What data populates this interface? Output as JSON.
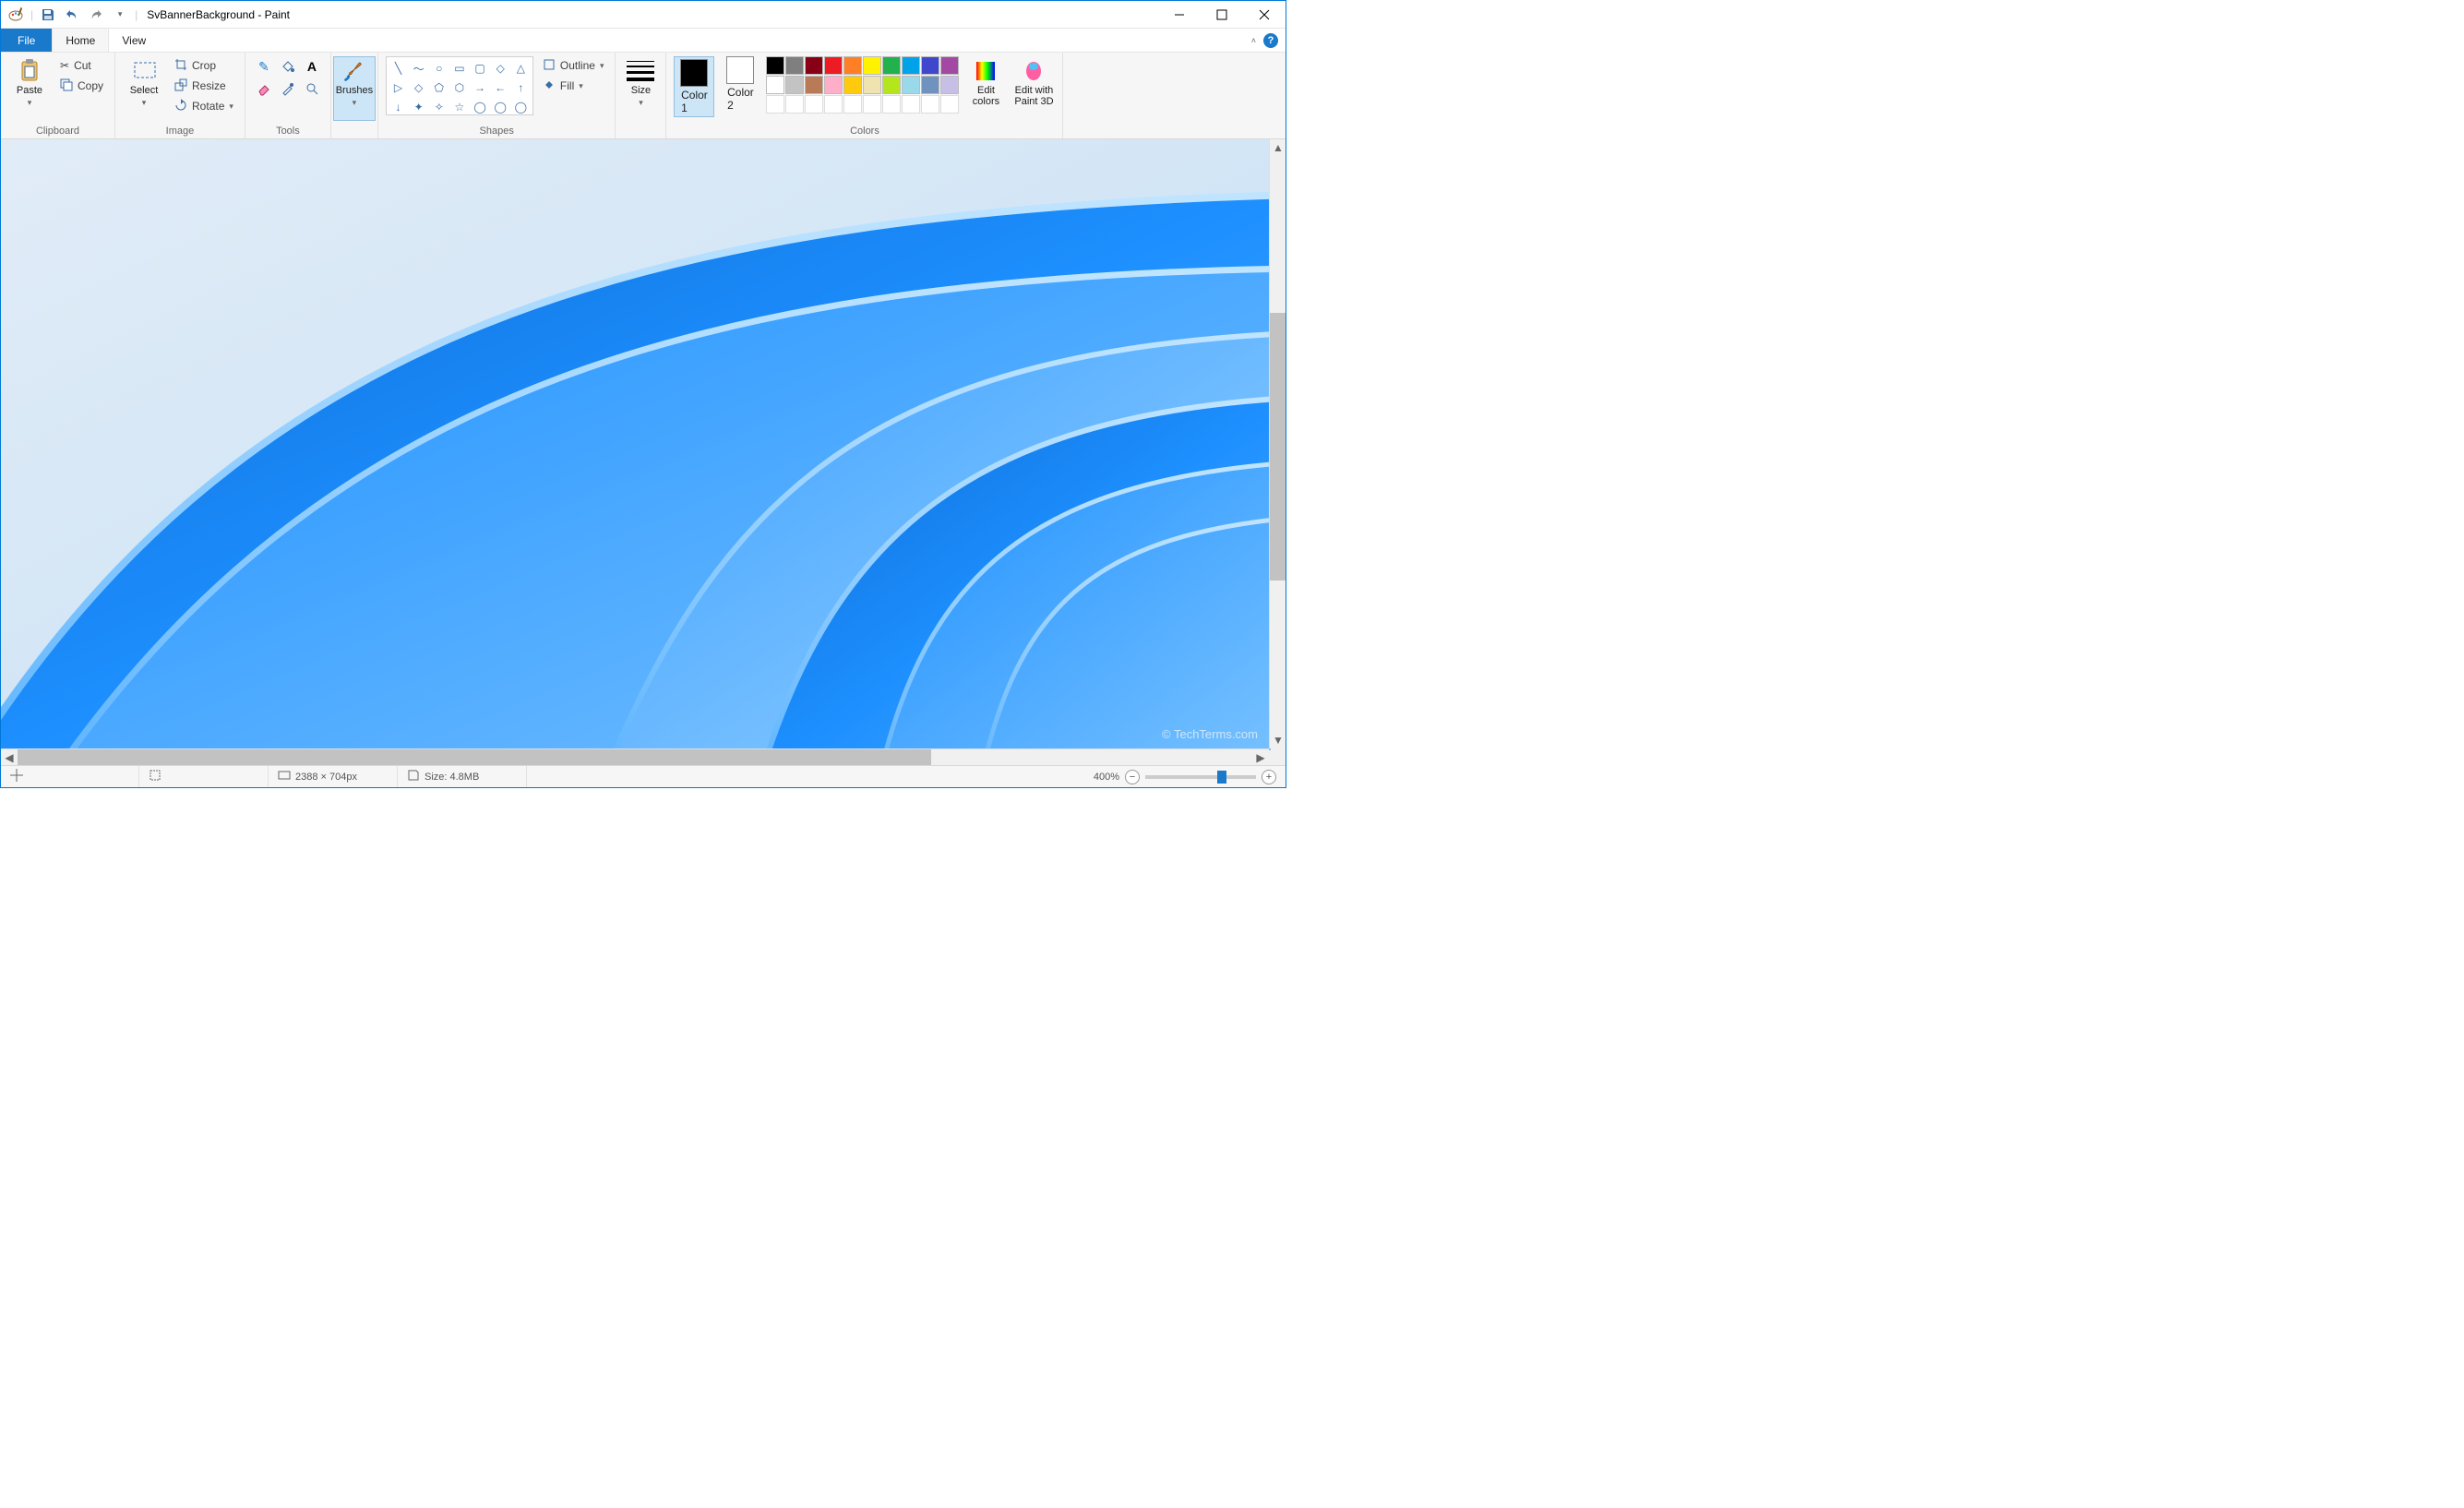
{
  "title": "SvBannerBackground - Paint",
  "qat": {
    "save": "save-icon",
    "undo": "undo-icon",
    "redo": "redo-icon"
  },
  "tabs": {
    "file": "File",
    "home": "Home",
    "view": "View"
  },
  "ribbon": {
    "clipboard": {
      "label": "Clipboard",
      "paste": "Paste",
      "cut": "Cut",
      "copy": "Copy"
    },
    "image": {
      "label": "Image",
      "select": "Select",
      "crop": "Crop",
      "resize": "Resize",
      "rotate": "Rotate"
    },
    "tools": {
      "label": "Tools"
    },
    "brushes": {
      "label": "Brushes"
    },
    "shapes": {
      "label": "Shapes",
      "outline": "Outline",
      "fill": "Fill"
    },
    "size": {
      "label": "Size"
    },
    "colors": {
      "label": "Colors",
      "color1_label": "Color\n1",
      "color2_label": "Color\n2",
      "color1_value": "#000000",
      "color2_value": "#ffffff",
      "editcolors": "Edit\ncolors",
      "paint3d": "Edit with\nPaint 3D",
      "row1": [
        "#000000",
        "#7f7f7f",
        "#880015",
        "#ed1c24",
        "#ff7f27",
        "#fff200",
        "#22b14c",
        "#00a2e8",
        "#3f48cc",
        "#a349a4"
      ],
      "row2": [
        "#ffffff",
        "#c3c3c3",
        "#b97a57",
        "#ffaec9",
        "#ffc90e",
        "#efe4b0",
        "#b5e61d",
        "#99d9ea",
        "#7092be",
        "#c8bfe7"
      ],
      "row3": [
        "",
        "",
        "",
        "",
        "",
        "",
        "",
        "",
        "",
        ""
      ]
    }
  },
  "status": {
    "pointer": "",
    "selection": "",
    "dimensions": "2388 × 704px",
    "filesize": "Size: 4.8MB",
    "zoom": "400%"
  },
  "watermark": "© TechTerms.com"
}
